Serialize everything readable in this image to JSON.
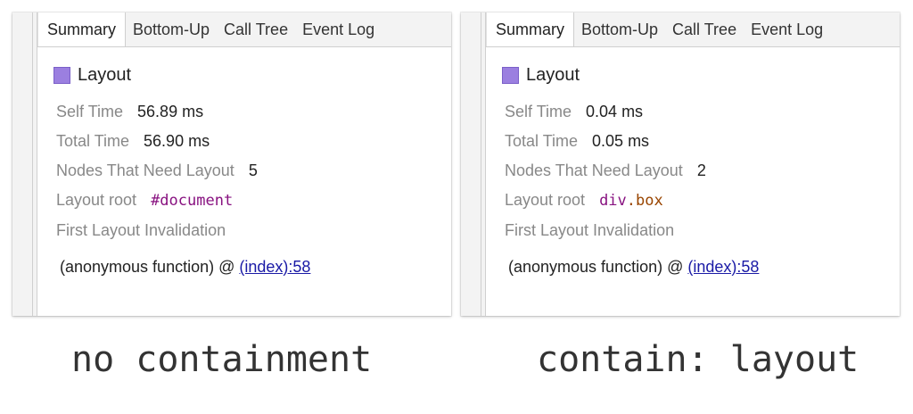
{
  "tabs": [
    "Summary",
    "Bottom-Up",
    "Call Tree",
    "Event Log"
  ],
  "panels": [
    {
      "title": "Layout",
      "swatch_color": "#9b7fe0",
      "self_time_label": "Self Time",
      "self_time": "56.89 ms",
      "total_time_label": "Total Time",
      "total_time": "56.90 ms",
      "nodes_label": "Nodes That Need Layout",
      "nodes": "5",
      "layout_root_label": "Layout root",
      "layout_root_tag": "#document",
      "layout_root_suffix": "",
      "first_invalidation_label": "First Layout Invalidation",
      "stack_fn": "(anonymous function) @ ",
      "stack_link": "(index):58"
    },
    {
      "title": "Layout",
      "swatch_color": "#9b7fe0",
      "self_time_label": "Self Time",
      "self_time": "0.04 ms",
      "total_time_label": "Total Time",
      "total_time": "0.05 ms",
      "nodes_label": "Nodes That Need Layout",
      "nodes": "2",
      "layout_root_label": "Layout root",
      "layout_root_tag": "div",
      "layout_root_suffix": ".box",
      "first_invalidation_label": "First Layout Invalidation",
      "stack_fn": "(anonymous function) @ ",
      "stack_link": "(index):58"
    }
  ],
  "captions": [
    "no containment",
    "contain: layout"
  ]
}
